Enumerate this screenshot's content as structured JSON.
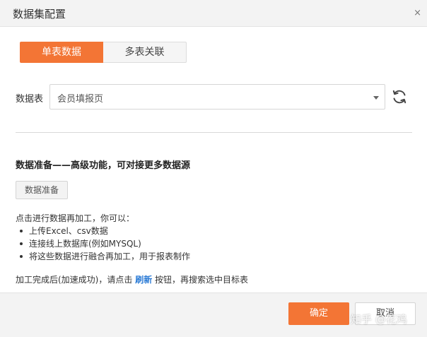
{
  "dialog": {
    "title": "数据集配置",
    "close_glyph": "×"
  },
  "tabs": [
    {
      "label": "单表数据",
      "active": true
    },
    {
      "label": "多表关联",
      "active": false
    }
  ],
  "table_field": {
    "label": "数据表",
    "value": "会员填报页",
    "refresh_icon": "refresh-icon"
  },
  "prep": {
    "heading": "数据准备——高级功能，可对接更多数据源",
    "button_label": "数据准备",
    "intro": "点击进行数据再加工，你可以：",
    "bullets": [
      "上传Excel、csv数据",
      "连接线上数据库(例如MYSQL)",
      "将这些数据进行融合再加工，用于报表制作"
    ],
    "note_before": "加工完成后(加速成功)，请点击 ",
    "note_link": "刷新",
    "note_after": " 按钮，再搜索选中目标表"
  },
  "actions": {
    "ok_label": "确定",
    "cancel_label": "取消"
  },
  "watermark": "知乎 @花鸡",
  "colors": {
    "accent": "#f37535",
    "link": "#2b7bd6"
  }
}
